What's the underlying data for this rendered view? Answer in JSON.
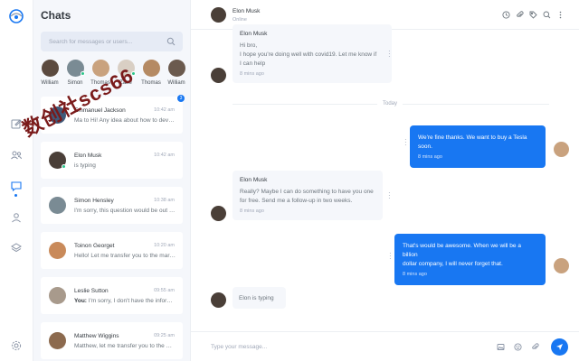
{
  "colors": {
    "accent": "#1877f2",
    "online": "#2bc48a",
    "sidebar_bg": "#f5f7fb"
  },
  "sidebar": {
    "title": "Chats",
    "search_placeholder": "Search for messages or users...",
    "stories": [
      {
        "name": "William",
        "online": false,
        "color": "#5b4a3f"
      },
      {
        "name": "Simon",
        "online": true,
        "color": "#7a8b94"
      },
      {
        "name": "Thomas",
        "online": false,
        "color": "#c9a27e"
      },
      {
        "name": "Zane",
        "online": true,
        "color": "#d9cfc4"
      },
      {
        "name": "Thomas",
        "online": false,
        "color": "#b58a63"
      },
      {
        "name": "William",
        "online": false,
        "color": "#6b5a4e"
      }
    ],
    "chats": [
      {
        "name": "Emmanuel Jackson",
        "time": "10:42 am",
        "message": "Ma to Hi! Any idea about how to develop",
        "badge": "3",
        "online": false,
        "color": "#3f5a7a"
      },
      {
        "name": "Elon Musk",
        "time": "10:42 am",
        "message": "is typing",
        "badge": "",
        "online": true,
        "color": "#4a3f38"
      },
      {
        "name": "Simon Hensley",
        "time": "10:38 am",
        "message": "I'm sorry, this question would be out of my",
        "badge": "",
        "online": false,
        "color": "#7a8b94"
      },
      {
        "name": "Toinon Georget",
        "time": "10:20 am",
        "message": "Hello! Let me transfer you to the marketing",
        "badge": "",
        "online": false,
        "color": "#c98a5a"
      },
      {
        "name": "Leslie Sutton",
        "time": "09:55 am",
        "message_prefix": "You:",
        "message": "I'm sorry, I don't have the information",
        "badge": "",
        "online": false,
        "color": "#a89a8c"
      },
      {
        "name": "Matthew Wiggins",
        "time": "09:25 am",
        "message": "Matthew, let me transfer you to the marketing",
        "badge": "",
        "online": false,
        "color": "#8c6a4e"
      }
    ]
  },
  "header": {
    "name": "Elon Musk",
    "status": "Online",
    "icons": [
      "clock-icon",
      "paperclip-icon",
      "tag-icon",
      "search-icon",
      "more-icon"
    ]
  },
  "messages": {
    "m1": {
      "sender": "Elon Musk",
      "lines": [
        "Hi bro,",
        "I hope you're doing well with covid19. Let me know if",
        "I can help"
      ],
      "time": "8 mins ago"
    },
    "divider": "Today",
    "m2": {
      "lines": [
        "We're fine thanks. We want to buy a Tesla soon."
      ],
      "time": "8 mins ago"
    },
    "m3": {
      "sender": "Elon Musk",
      "lines": [
        "Really? Maybe I can do something to have you one",
        "for free. Send me a follow-up in two weeks."
      ],
      "time": "8 mins ago"
    },
    "m4": {
      "lines": [
        "That's would be awesome. When we will be a billion",
        "dollar company, I will never forget that."
      ],
      "time": "8 mins ago"
    },
    "typing": "Elon is typing"
  },
  "composer": {
    "placeholder": "Type your message..."
  },
  "watermark": "数创社scs66"
}
